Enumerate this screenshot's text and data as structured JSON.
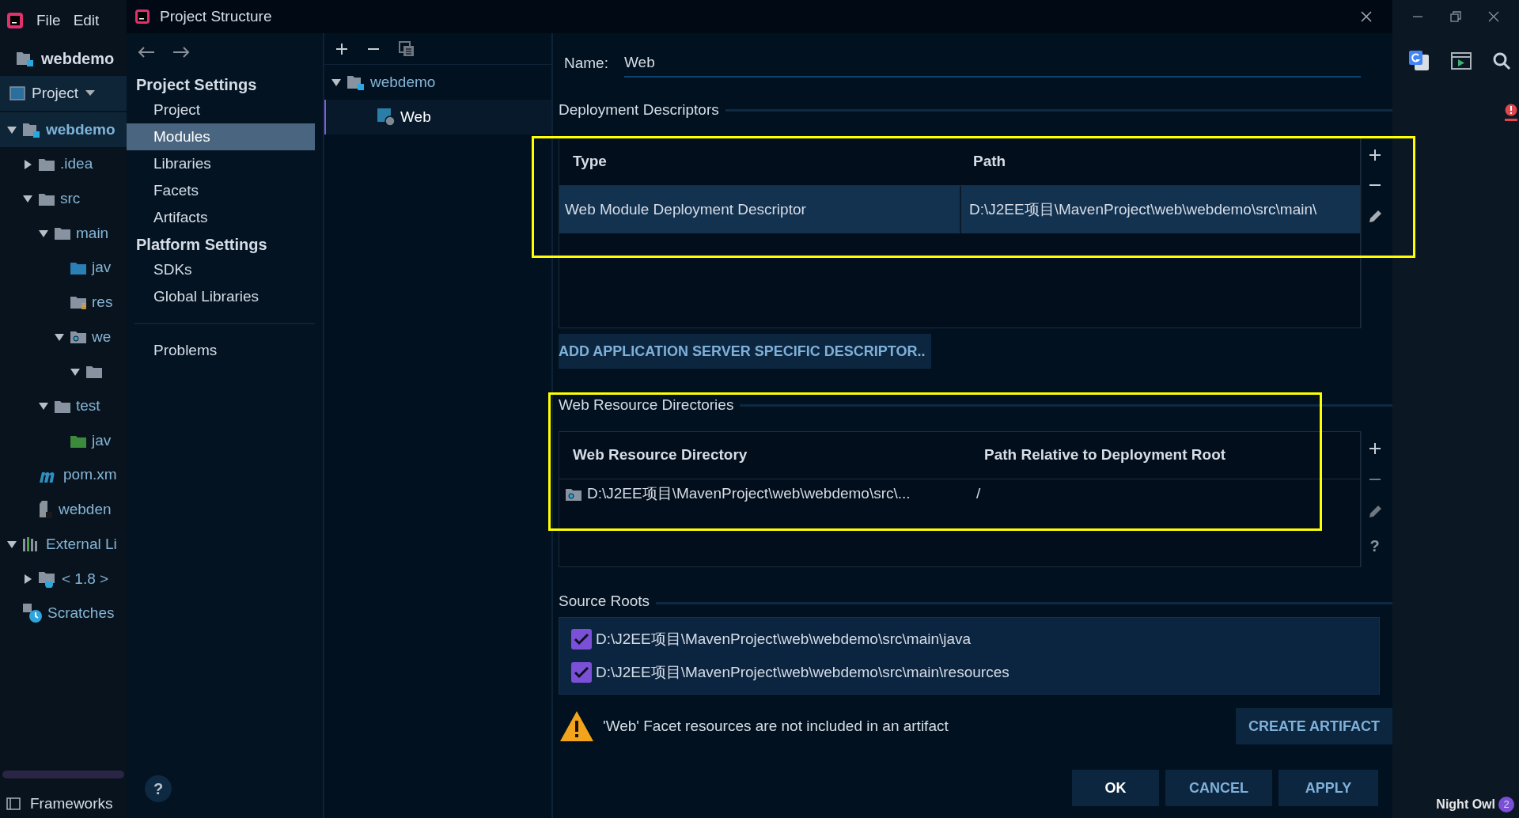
{
  "ide": {
    "menu": [
      "File",
      "Edit"
    ],
    "project_name": "webdemo",
    "view_selector": "Project",
    "tree": [
      {
        "label": "webdemo",
        "kind": "module",
        "expanded": true,
        "selected": true,
        "children": [
          {
            "label": ".idea",
            "kind": "folder",
            "expanded": false
          },
          {
            "label": "src",
            "kind": "folder",
            "expanded": true,
            "children": [
              {
                "label": "main",
                "kind": "folder",
                "expanded": true,
                "children": [
                  {
                    "label": "jav",
                    "kind": "source-folder"
                  },
                  {
                    "label": "res",
                    "kind": "resource-folder"
                  },
                  {
                    "label": "we",
                    "kind": "web-folder",
                    "expanded": true,
                    "children": [
                      {
                        "kind": "folder",
                        "expanded": true
                      }
                    ]
                  }
                ]
              },
              {
                "label": "test",
                "kind": "folder",
                "expanded": true,
                "children": [
                  {
                    "label": "jav",
                    "kind": "test-folder"
                  }
                ]
              }
            ]
          },
          {
            "label": "pom.xm",
            "kind": "maven"
          },
          {
            "label": "webden",
            "kind": "iml"
          }
        ]
      },
      {
        "label": "External Li",
        "kind": "libraries",
        "expanded": true,
        "children": [
          {
            "label": "< 1.8 >",
            "kind": "jdk",
            "expanded": false
          }
        ]
      },
      {
        "label": "Scratches",
        "kind": "scratches"
      }
    ],
    "tool_window": "Frameworks",
    "status": {
      "theme": "Night Owl",
      "notifications": "2"
    }
  },
  "dialog": {
    "title": "Project Structure",
    "nav_groups": [
      {
        "items": [
          {
            "kind": "header",
            "label": "Project Settings"
          },
          {
            "kind": "item",
            "label": "Project",
            "selected": false
          },
          {
            "kind": "item",
            "label": "Modules",
            "selected": true
          },
          {
            "kind": "item",
            "label": "Libraries",
            "selected": false
          },
          {
            "kind": "item",
            "label": "Facets",
            "selected": false
          },
          {
            "kind": "item",
            "label": "Artifacts",
            "selected": false
          },
          {
            "kind": "header",
            "label": "Platform Settings"
          },
          {
            "kind": "item",
            "label": "SDKs",
            "selected": false
          },
          {
            "kind": "item",
            "label": "Global Libraries",
            "selected": false
          }
        ]
      },
      {
        "items": [
          {
            "kind": "item",
            "label": "Problems",
            "selected": false
          }
        ]
      }
    ],
    "modules": [
      {
        "label": "webdemo",
        "kind": "module",
        "expanded": true,
        "selected": false,
        "children": [
          {
            "label": "Web",
            "kind": "web-facet",
            "selected": true
          }
        ]
      }
    ],
    "name_label": "Name:",
    "name_value": "Web",
    "deployment": {
      "title": "Deployment Descriptors",
      "columns": [
        "Type",
        "Path"
      ],
      "rows": [
        {
          "cells": [
            "Web Module Deployment Descriptor",
            "D:\\J2EE项目\\MavenProject\\web\\webdemo\\src\\main\\"
          ],
          "selected": true
        }
      ],
      "add_button": "ADD APPLICATION SERVER SPECIFIC DESCRIPTOR.."
    },
    "resources": {
      "title": "Web Resource Directories",
      "columns": [
        "Web Resource Directory",
        "Path Relative to Deployment Root"
      ],
      "rows": [
        {
          "cells": [
            "D:\\J2EE项目\\MavenProject\\web\\webdemo\\src\\...",
            "/"
          ],
          "selected": false
        }
      ],
      "help": "?"
    },
    "source_roots": {
      "title": "Source Roots",
      "items": [
        {
          "path": "D:\\J2EE项目\\MavenProject\\web\\webdemo\\src\\main\\java",
          "checked": true
        },
        {
          "path": "D:\\J2EE项目\\MavenProject\\web\\webdemo\\src\\main\\resources",
          "checked": true
        }
      ]
    },
    "warning": "'Web' Facet resources are not included in an artifact",
    "warning_action": "CREATE ARTIFACT",
    "buttons": [
      "OK",
      "CANCEL",
      "APPLY"
    ],
    "help_button": "?"
  }
}
